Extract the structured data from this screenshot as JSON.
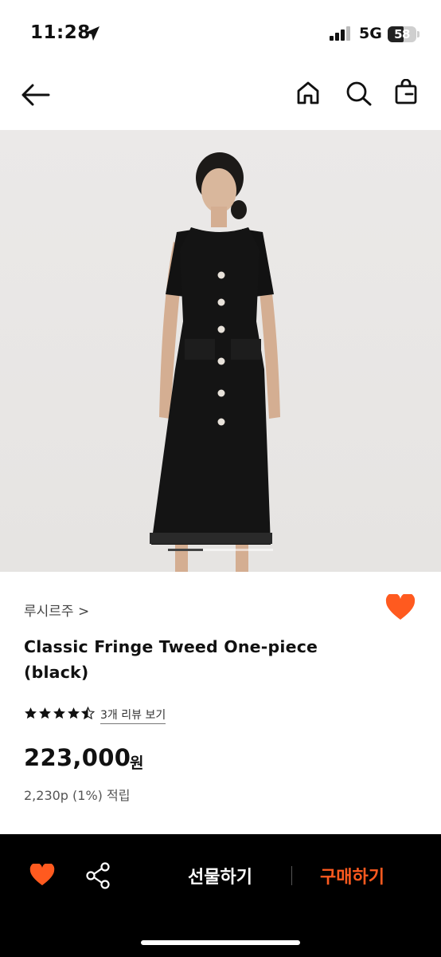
{
  "status_bar": {
    "time": "11:28",
    "network": "5G",
    "battery": "58"
  },
  "nav": {
    "icons": [
      "back-arrow-icon",
      "home-icon",
      "search-icon",
      "bag-icon"
    ]
  },
  "product": {
    "brand": "루시르주 >",
    "title": "Classic Fringe Tweed One-piece (black)",
    "rating": 4.5,
    "review_link": "3개 리뷰 보기",
    "price": "223,000",
    "currency": "원",
    "points": "2,230p (1%) 적립"
  },
  "bottom_bar": {
    "gift_label": "선물하기",
    "buy_label": "구매하기"
  },
  "colors": {
    "accent": "#ff5a1f",
    "bottom_bar_bg": "#000000",
    "text": "#111111"
  }
}
